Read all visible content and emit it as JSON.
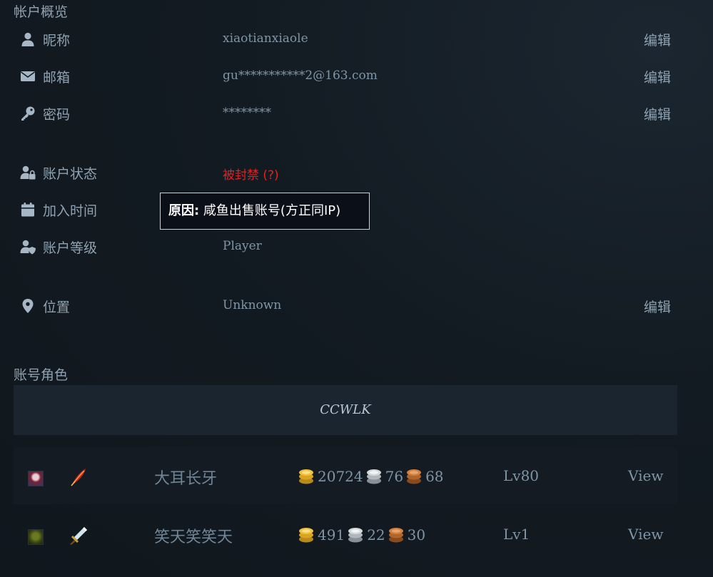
{
  "account_overview": {
    "title": "帐户概览",
    "rows": [
      {
        "label": "昵称",
        "value": "xiaotianxiaole",
        "edit": "编辑",
        "icon": "user-icon"
      },
      {
        "label": "邮箱",
        "value": "gu***********2@163.com",
        "edit": "编辑",
        "icon": "envelope-icon"
      },
      {
        "label": "密码",
        "value": "********",
        "edit": "编辑",
        "icon": "key-icon"
      },
      {
        "label": "账户状态",
        "value": "被封禁 (?)",
        "icon": "user-lock-icon",
        "value_color": "#e81f1f"
      },
      {
        "label": "加入时间",
        "value": "",
        "icon": "calendar-icon"
      },
      {
        "label": "账户等级",
        "value": "Player",
        "icon": "user-shield-icon"
      },
      {
        "label": "位置",
        "value": "Unknown",
        "edit": "编辑",
        "icon": "map-marker-icon"
      }
    ],
    "tooltip": {
      "prefix": "原因:",
      "text": " 咸鱼出售账号(方正同IP)"
    }
  },
  "characters": {
    "title": "账号角色",
    "realm": "CCWLK",
    "list": [
      {
        "avatar": "blood-elf-avatar",
        "spec_icon": "feather-icon",
        "name": "大耳长牙",
        "gold": "20724",
        "silver": "76",
        "copper": "68",
        "level": "Lv80",
        "view": "View"
      },
      {
        "avatar": "orc-avatar",
        "spec_icon": "sword-icon",
        "name": "笑天笑笑天",
        "gold": "491",
        "silver": "22",
        "copper": "30",
        "level": "Lv1",
        "view": "View"
      }
    ]
  },
  "colors": {
    "banned": "#e81f1f",
    "background": "#131b22",
    "realm_bar": "#1a2530"
  }
}
